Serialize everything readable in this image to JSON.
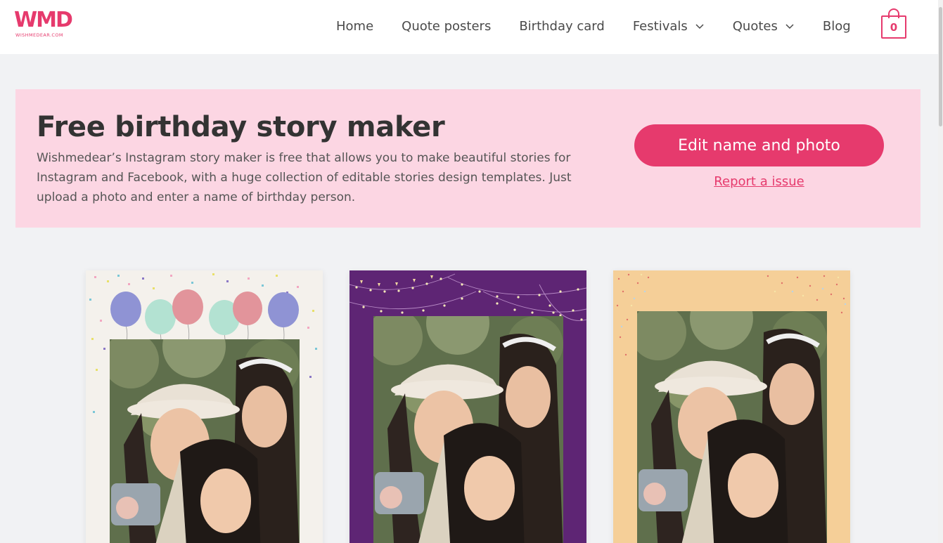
{
  "header": {
    "logo_text": "WMD",
    "logo_sub": "WISHMEDEAR.COM",
    "nav": [
      {
        "label": "Home",
        "has_dropdown": false
      },
      {
        "label": "Quote posters",
        "has_dropdown": false
      },
      {
        "label": "Birthday card",
        "has_dropdown": false
      },
      {
        "label": "Festivals",
        "has_dropdown": true
      },
      {
        "label": "Quotes",
        "has_dropdown": true
      },
      {
        "label": "Blog",
        "has_dropdown": false
      }
    ],
    "cart_count": "0",
    "icons": {
      "cart": "shopping-bag-icon",
      "dropdown": "chevron-down-icon"
    }
  },
  "hero": {
    "title": "Free birthday story maker",
    "description": "Wishmedear’s Instagram story maker is free that allows you to make beautiful stories for Instagram and Facebook, with a huge collection of editable stories design templates. Just upload a photo and enter a name of birthday person.",
    "cta_label": "Edit name and photo",
    "report_label": "Report a issue"
  },
  "templates": [
    {
      "name": "balloons",
      "background": "#f4f1ec"
    },
    {
      "name": "purple-lights",
      "background": "#5e2574"
    },
    {
      "name": "peach-confetti",
      "background": "#f5cf98"
    }
  ],
  "colors": {
    "accent": "#e63a6d",
    "hero_bg": "#fcd6e3",
    "page_bg": "#f1f2f4"
  }
}
